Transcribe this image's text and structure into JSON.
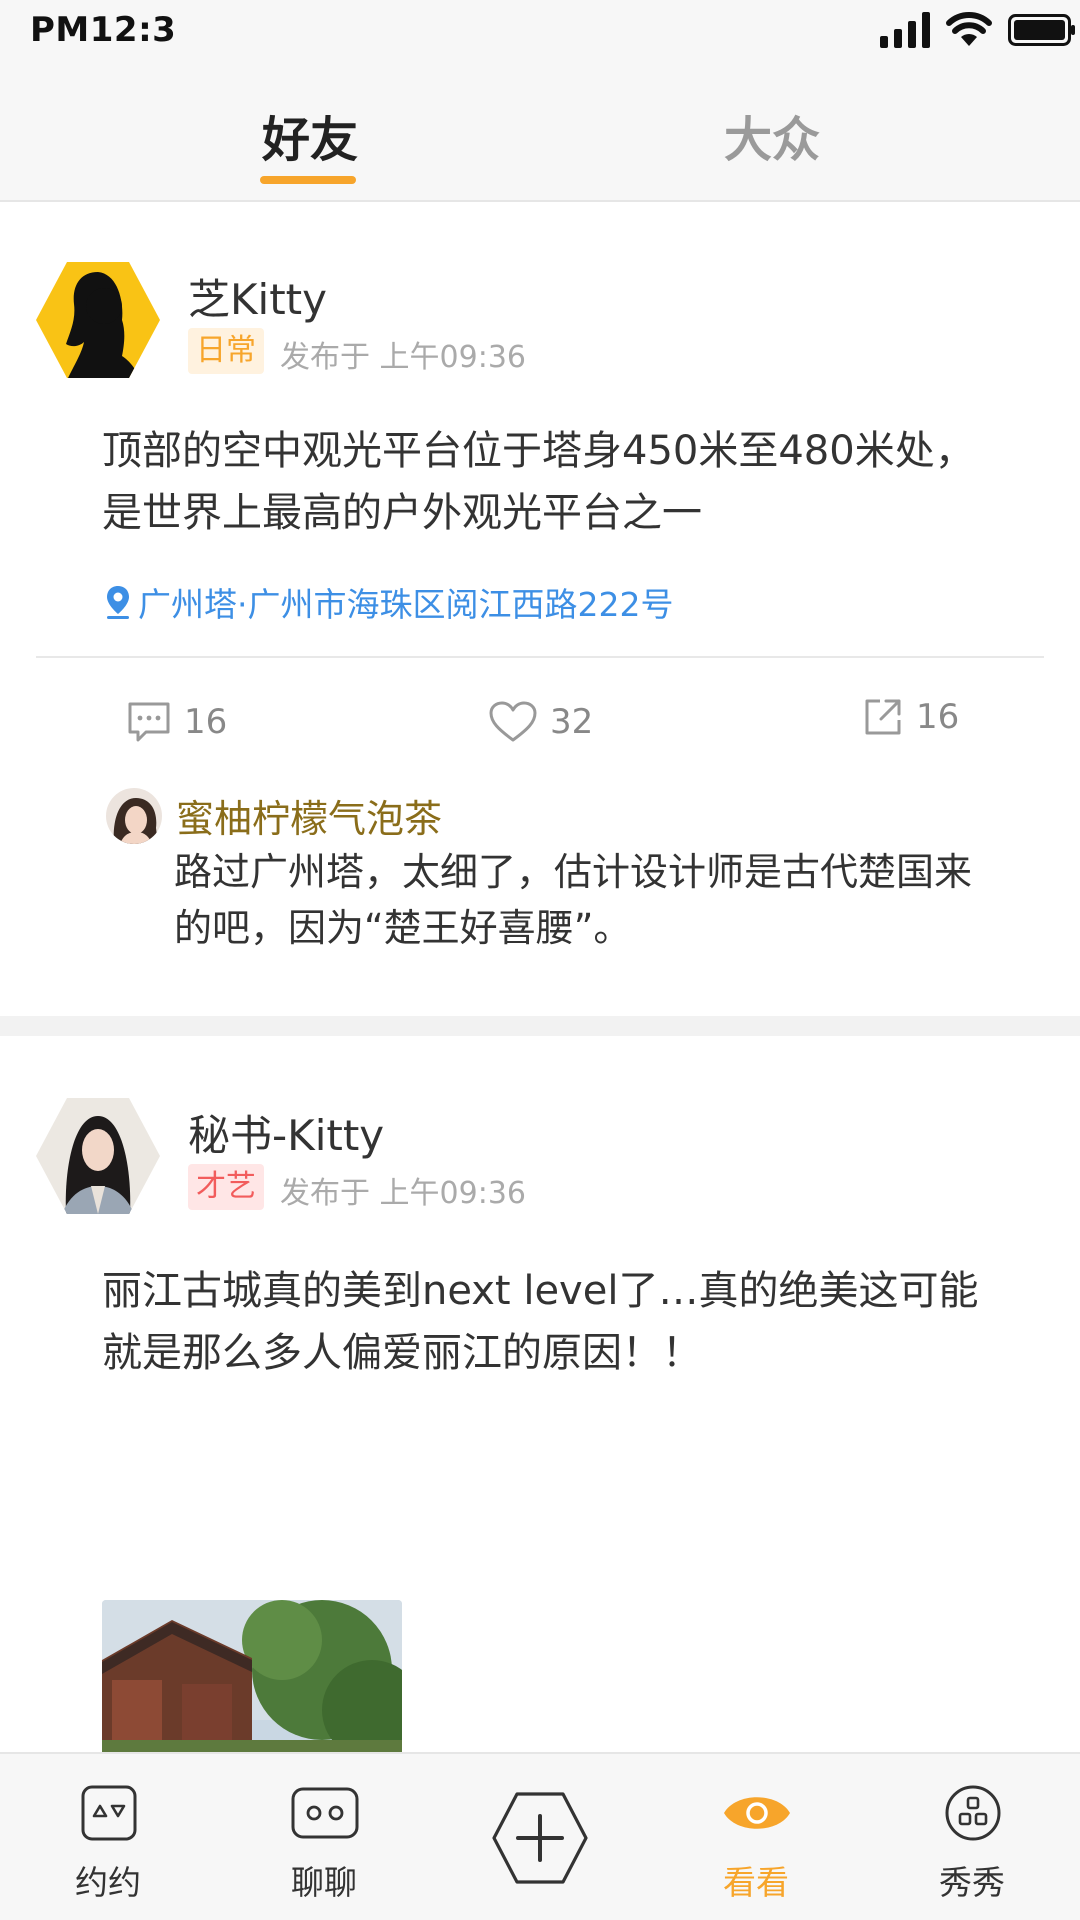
{
  "status_bar": {
    "time": "PM12:3"
  },
  "top_tabs": [
    {
      "label": "好友",
      "active": true
    },
    {
      "label": "大众",
      "active": false
    }
  ],
  "colors": {
    "accent": "#f7a52b",
    "link": "#3d8fe5",
    "tag_daily_text": "#f7a52b",
    "tag_art_text": "#f25c5c",
    "commenter": "#8a6d1a"
  },
  "posts": [
    {
      "username": "芝Kitty",
      "tag": "日常",
      "meta": "发布于 上午09:36",
      "text": "顶部的空中观光平台位于塔身450米至480米处，是世界上最高的户外观光平台之一",
      "location": "广州塔·广州市海珠区阅江西路222号",
      "comments_count": "16",
      "likes_count": "32",
      "shares_count": "16",
      "comment": {
        "author": "蜜柚柠檬气泡茶",
        "text": "路过广州塔，太细了，估计设计师是古代楚国来的吧，因为“楚王好喜腰”。"
      }
    },
    {
      "username": "秘书-Kitty",
      "tag": "才艺",
      "meta": "发布于 上午09:36",
      "text": "丽江古城真的美到next level了…真的绝美这可能就是那么多人偏爱丽江的原因！！"
    }
  ],
  "bottom_nav": [
    {
      "label": "约约",
      "icon": "date-icon",
      "active": false
    },
    {
      "label": "聊聊",
      "icon": "chat-icon",
      "active": false
    },
    {
      "label": "",
      "icon": "plus-icon",
      "active": false
    },
    {
      "label": "看看",
      "icon": "eye-icon",
      "active": true
    },
    {
      "label": "秀秀",
      "icon": "show-icon",
      "active": false
    }
  ]
}
